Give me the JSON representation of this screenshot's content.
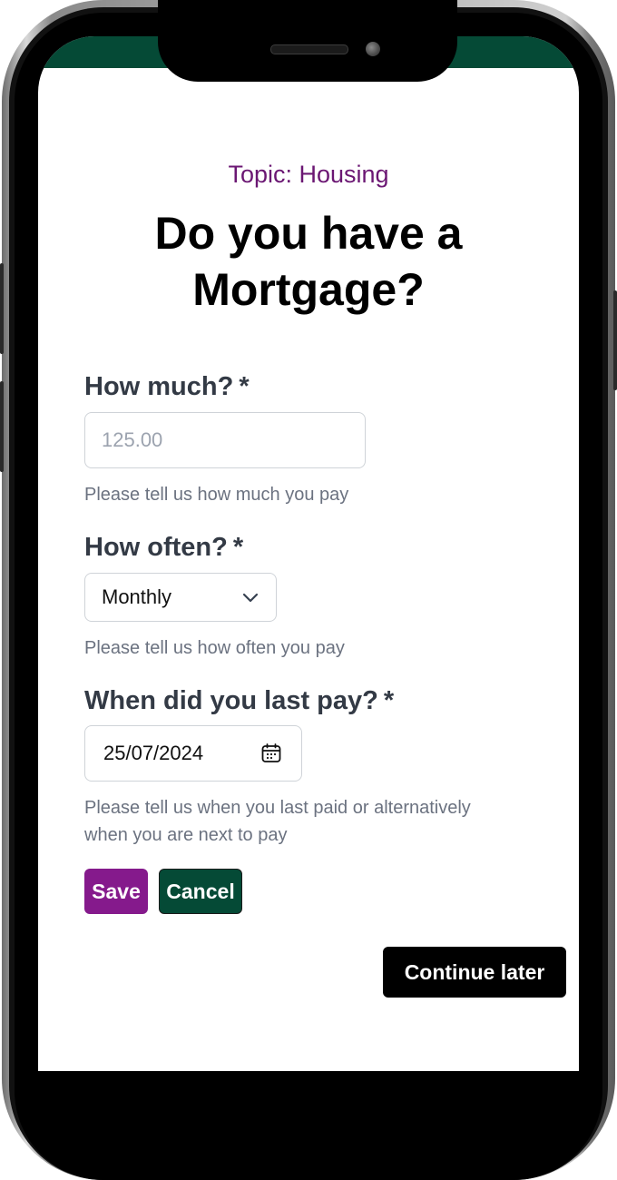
{
  "topic": "Topic: Housing",
  "title_line1": "Do you have a",
  "title_line2": "Mortgage?",
  "fields": {
    "amount": {
      "label": "How much?",
      "required_mark": "*",
      "placeholder": "125.00",
      "hint": "Please tell us how much you pay"
    },
    "frequency": {
      "label": "How often?",
      "required_mark": "*",
      "selected": "Monthly",
      "hint": "Please tell us how often you pay"
    },
    "last_paid": {
      "label": "When did you last pay?",
      "required_mark": "*",
      "value": "25/07/2024",
      "hint_line1": "Please tell us when you last paid or alternatively",
      "hint_line2": "when you are next to pay"
    }
  },
  "buttons": {
    "save": "Save",
    "cancel": "Cancel",
    "continue_later": "Continue later"
  },
  "colors": {
    "brand_green": "#054a36",
    "accent_purple": "#851a8c",
    "topic_purple": "#6b1773"
  },
  "icons": {
    "frequency_dropdown": "chevron-down-icon",
    "date_picker": "calendar-icon"
  }
}
